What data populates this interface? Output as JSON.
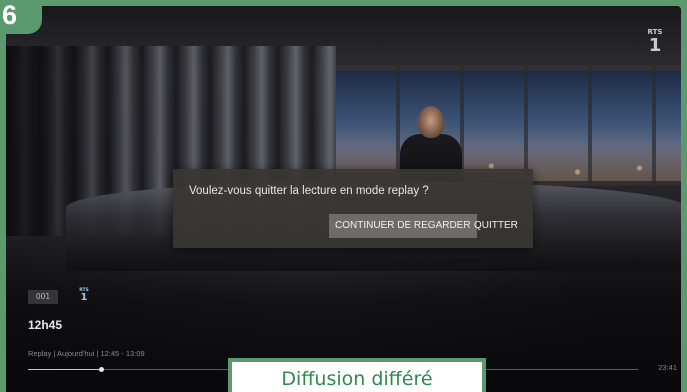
{
  "step_badge": "6",
  "channel_logo": {
    "brand": "RTS",
    "number": "1"
  },
  "dialog": {
    "message": "Voulez-vous quitter la lecture en mode replay ?",
    "continue_label": "CONTINUER DE REGARDER",
    "quit_label": "QUITTER"
  },
  "player": {
    "channel_number": "001",
    "channel_logo": {
      "brand": "RTS",
      "number": "1"
    },
    "program_title": "12h45",
    "replay_info": "Replay  |  Aujourd'hui  |  12:45 - 13:09",
    "end_time": "23:41",
    "progress_fraction": 0.12
  },
  "caption": "Diffusion différé",
  "colors": {
    "accent_green": "#5a9a6e",
    "caption_text": "#2e8a50",
    "dialog_bg": "#3a3634"
  }
}
